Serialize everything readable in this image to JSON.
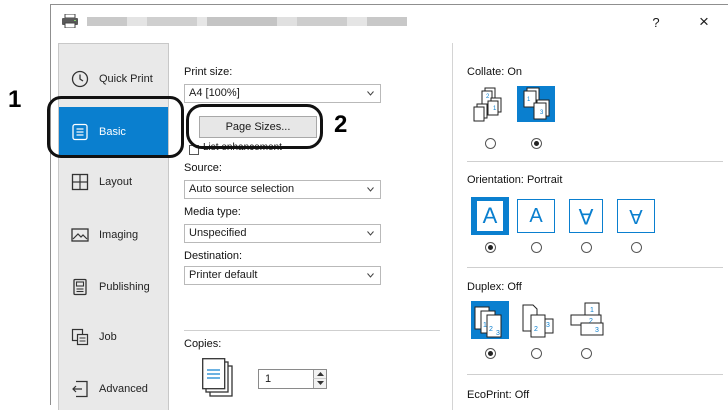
{
  "window": {
    "help_label": "?",
    "close_label": "×"
  },
  "sidebar": {
    "items": [
      {
        "label": "Quick Print",
        "icon": "quick-print-icon"
      },
      {
        "label": "Basic",
        "icon": "basic-icon",
        "active": true
      },
      {
        "label": "Layout",
        "icon": "layout-icon"
      },
      {
        "label": "Imaging",
        "icon": "imaging-icon"
      },
      {
        "label": "Publishing",
        "icon": "publishing-icon"
      },
      {
        "label": "Job",
        "icon": "job-icon"
      },
      {
        "label": "Advanced",
        "icon": "advanced-icon"
      }
    ]
  },
  "basic": {
    "print_size_label": "Print size:",
    "print_size_value": "A4 [100%]",
    "page_sizes_button": "Page Sizes...",
    "list_enhancement_label": "List enhancement",
    "source_label": "Source:",
    "source_value": "Auto source selection",
    "media_type_label": "Media type:",
    "media_type_value": "Unspecified",
    "destination_label": "Destination:",
    "destination_value": "Printer default",
    "copies_label": "Copies:",
    "copies_value": "1"
  },
  "options": {
    "collate_label": "Collate:",
    "collate_value": "On",
    "orientation_label": "Orientation:",
    "orientation_value": "Portrait",
    "duplex_label": "Duplex:",
    "duplex_value": "Off",
    "ecoprint_label": "EcoPrint:",
    "ecoprint_value": "Off",
    "orientation_glyph": "A"
  },
  "callouts": {
    "one": "1",
    "two": "2"
  },
  "colors": {
    "accent": "#0a7fcf",
    "sidebar_bg": "#e9e9e9"
  }
}
